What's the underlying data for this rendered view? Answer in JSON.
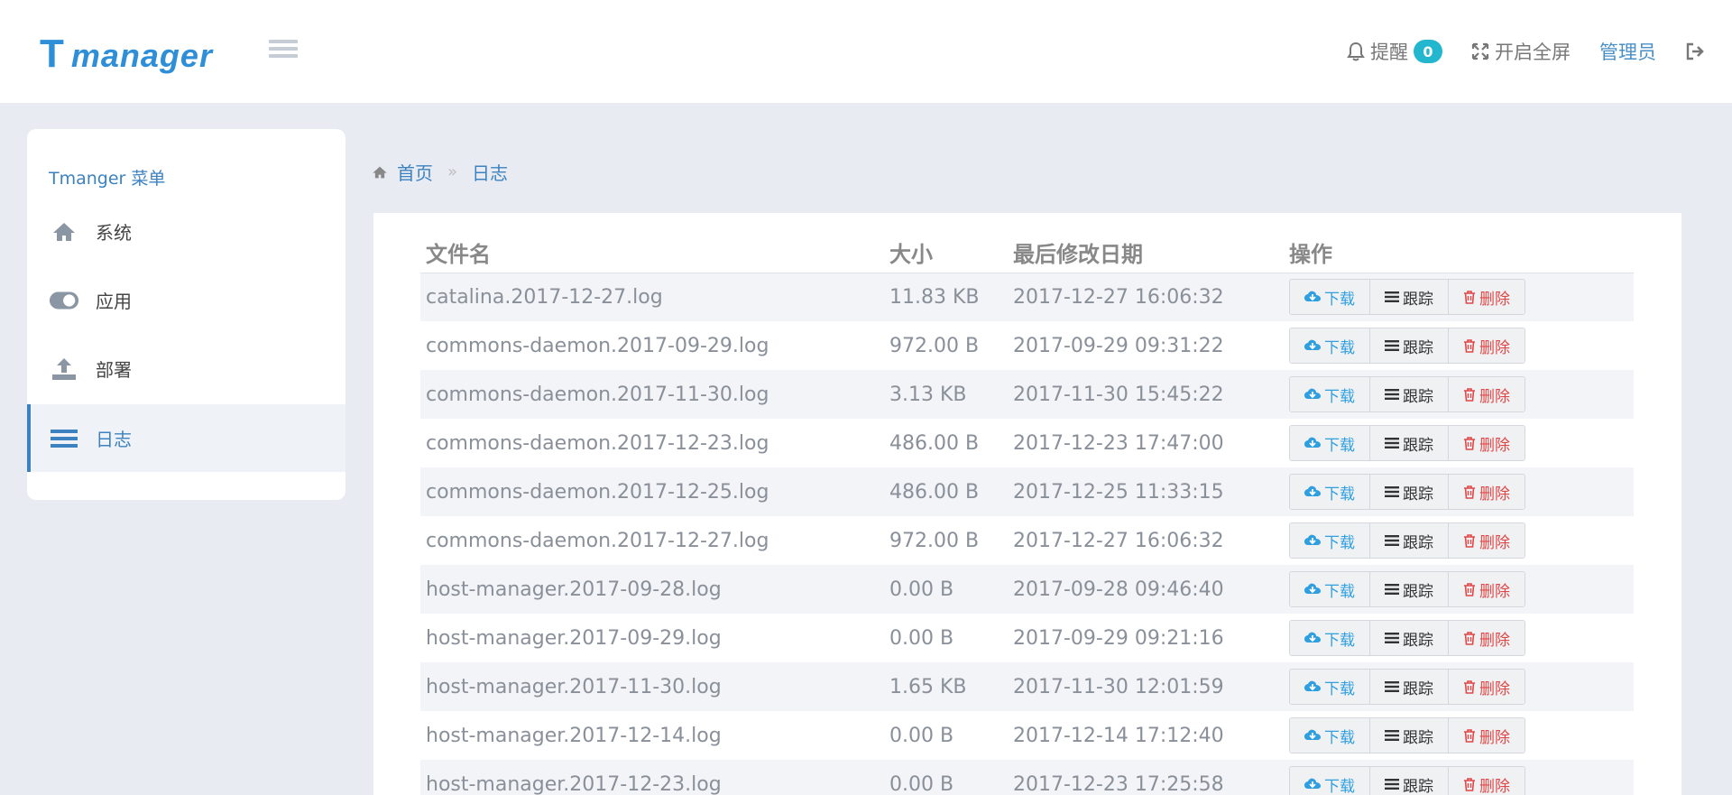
{
  "header": {
    "logo_t": "T",
    "logo_word": "manager",
    "remind_label": "提醒",
    "remind_count": "0",
    "fullscreen_label": "开启全屏",
    "admin_label": "管理员"
  },
  "sidebar": {
    "title": "Tmanger 菜单",
    "items": [
      {
        "label": "系统",
        "icon": "home-icon"
      },
      {
        "label": "应用",
        "icon": "toggle-icon"
      },
      {
        "label": "部署",
        "icon": "upload-icon"
      },
      {
        "label": "日志",
        "icon": "list-icon"
      }
    ],
    "active_index": 3
  },
  "breadcrumb": {
    "home": "首页",
    "current": "日志"
  },
  "table": {
    "headers": [
      "文件名",
      "大小",
      "最后修改日期",
      "操作"
    ],
    "actions": {
      "download": "下载",
      "trace": "跟踪",
      "delete": "删除"
    },
    "rows": [
      {
        "name": "catalina.2017-12-27.log",
        "size": "11.83 KB",
        "date": "2017-12-27 16:06:32"
      },
      {
        "name": "commons-daemon.2017-09-29.log",
        "size": "972.00 B",
        "date": "2017-09-29 09:31:22"
      },
      {
        "name": "commons-daemon.2017-11-30.log",
        "size": "3.13 KB",
        "date": "2017-11-30 15:45:22"
      },
      {
        "name": "commons-daemon.2017-12-23.log",
        "size": "486.00 B",
        "date": "2017-12-23 17:47:00"
      },
      {
        "name": "commons-daemon.2017-12-25.log",
        "size": "486.00 B",
        "date": "2017-12-25 11:33:15"
      },
      {
        "name": "commons-daemon.2017-12-27.log",
        "size": "972.00 B",
        "date": "2017-12-27 16:06:32"
      },
      {
        "name": "host-manager.2017-09-28.log",
        "size": "0.00 B",
        "date": "2017-09-28 09:46:40"
      },
      {
        "name": "host-manager.2017-09-29.log",
        "size": "0.00 B",
        "date": "2017-09-29 09:21:16"
      },
      {
        "name": "host-manager.2017-11-30.log",
        "size": "1.65 KB",
        "date": "2017-11-30 12:01:59"
      },
      {
        "name": "host-manager.2017-12-14.log",
        "size": "0.00 B",
        "date": "2017-12-14 17:12:40"
      },
      {
        "name": "host-manager.2017-12-23.log",
        "size": "0.00 B",
        "date": "2017-12-23 17:25:58"
      }
    ]
  }
}
